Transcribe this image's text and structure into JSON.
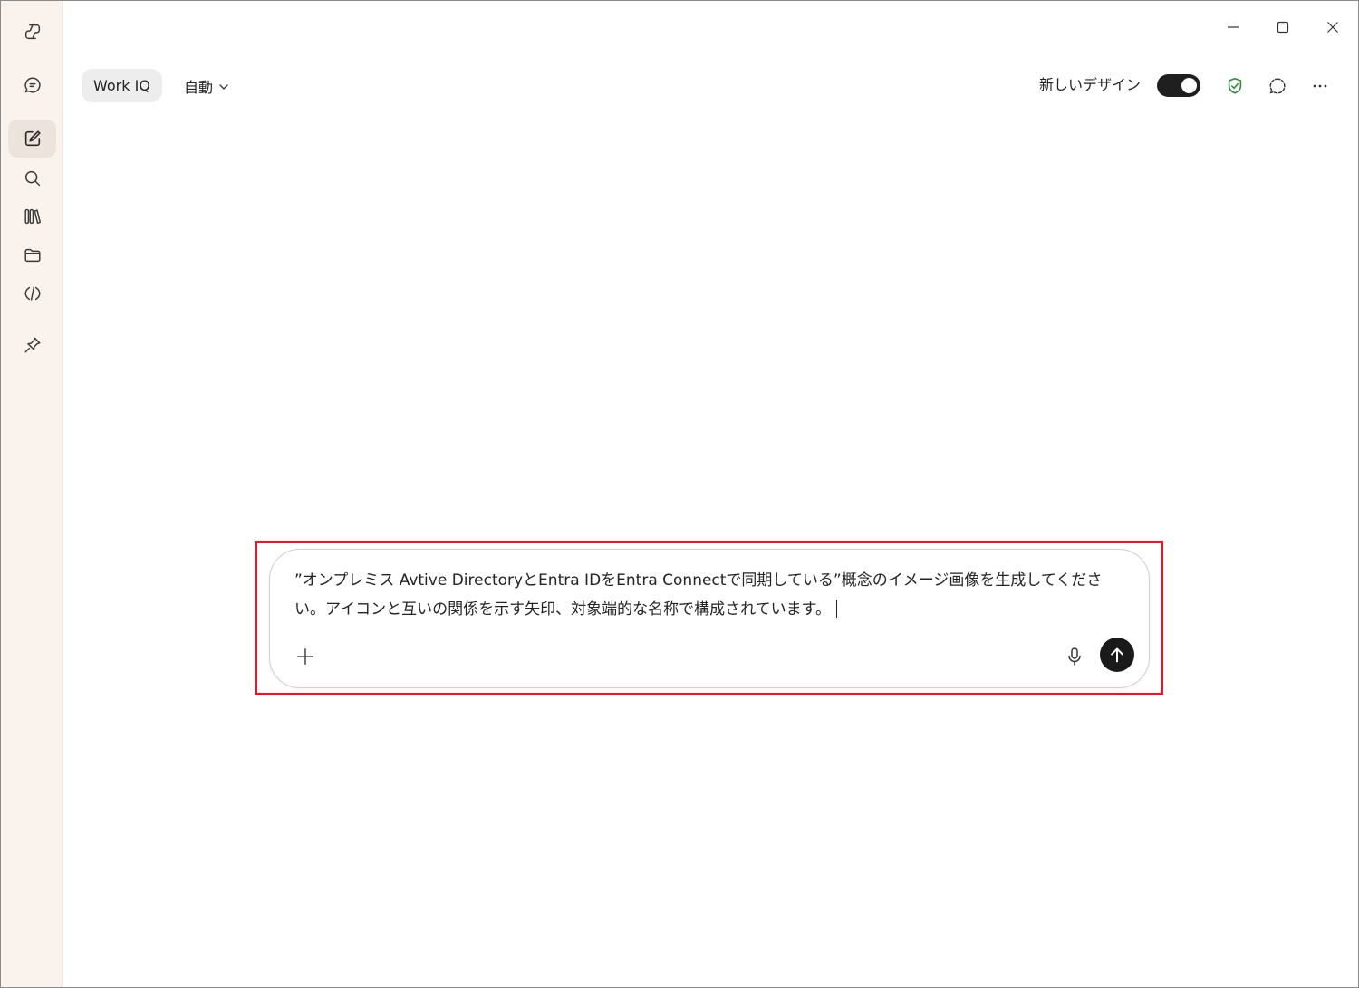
{
  "window": {
    "controls": [
      "minimize-icon",
      "maximize-icon",
      "close-icon"
    ]
  },
  "sidebar": {
    "items": [
      {
        "name": "copilot-logo-icon",
        "active": false
      },
      {
        "name": "chat-icon",
        "active": false
      },
      {
        "name": "new-chat-icon",
        "active": true
      },
      {
        "name": "search-icon",
        "active": false
      },
      {
        "name": "library-icon",
        "active": false
      },
      {
        "name": "folder-icon",
        "active": false
      },
      {
        "name": "code-icon",
        "active": false
      },
      {
        "name": "pin-icon",
        "active": false
      }
    ]
  },
  "toolbar": {
    "workiq_label": "Work IQ",
    "mode_label": "自動",
    "new_design_label": "新しいデザイン",
    "new_design_enabled": true,
    "icons": [
      "shield-check-icon",
      "chat-bubble-icon",
      "more-icon"
    ]
  },
  "composer": {
    "prompt_text": "”オンプレミス Avtive DirectoryとEntra IDをEntra Connectで同期している”概念のイメージ画像を生成してください。アイコンと互いの関係を示す矢印、対象端的な名称で構成されています。",
    "add_icon": "plus-icon",
    "mic_icon": "microphone-icon",
    "send_icon": "send-arrow-icon"
  },
  "colors": {
    "sidebar_bg": "#faf3ed",
    "highlight_border": "#e0192b",
    "shield_green": "#2e8b3a",
    "send_bg": "#1a1a1a"
  }
}
